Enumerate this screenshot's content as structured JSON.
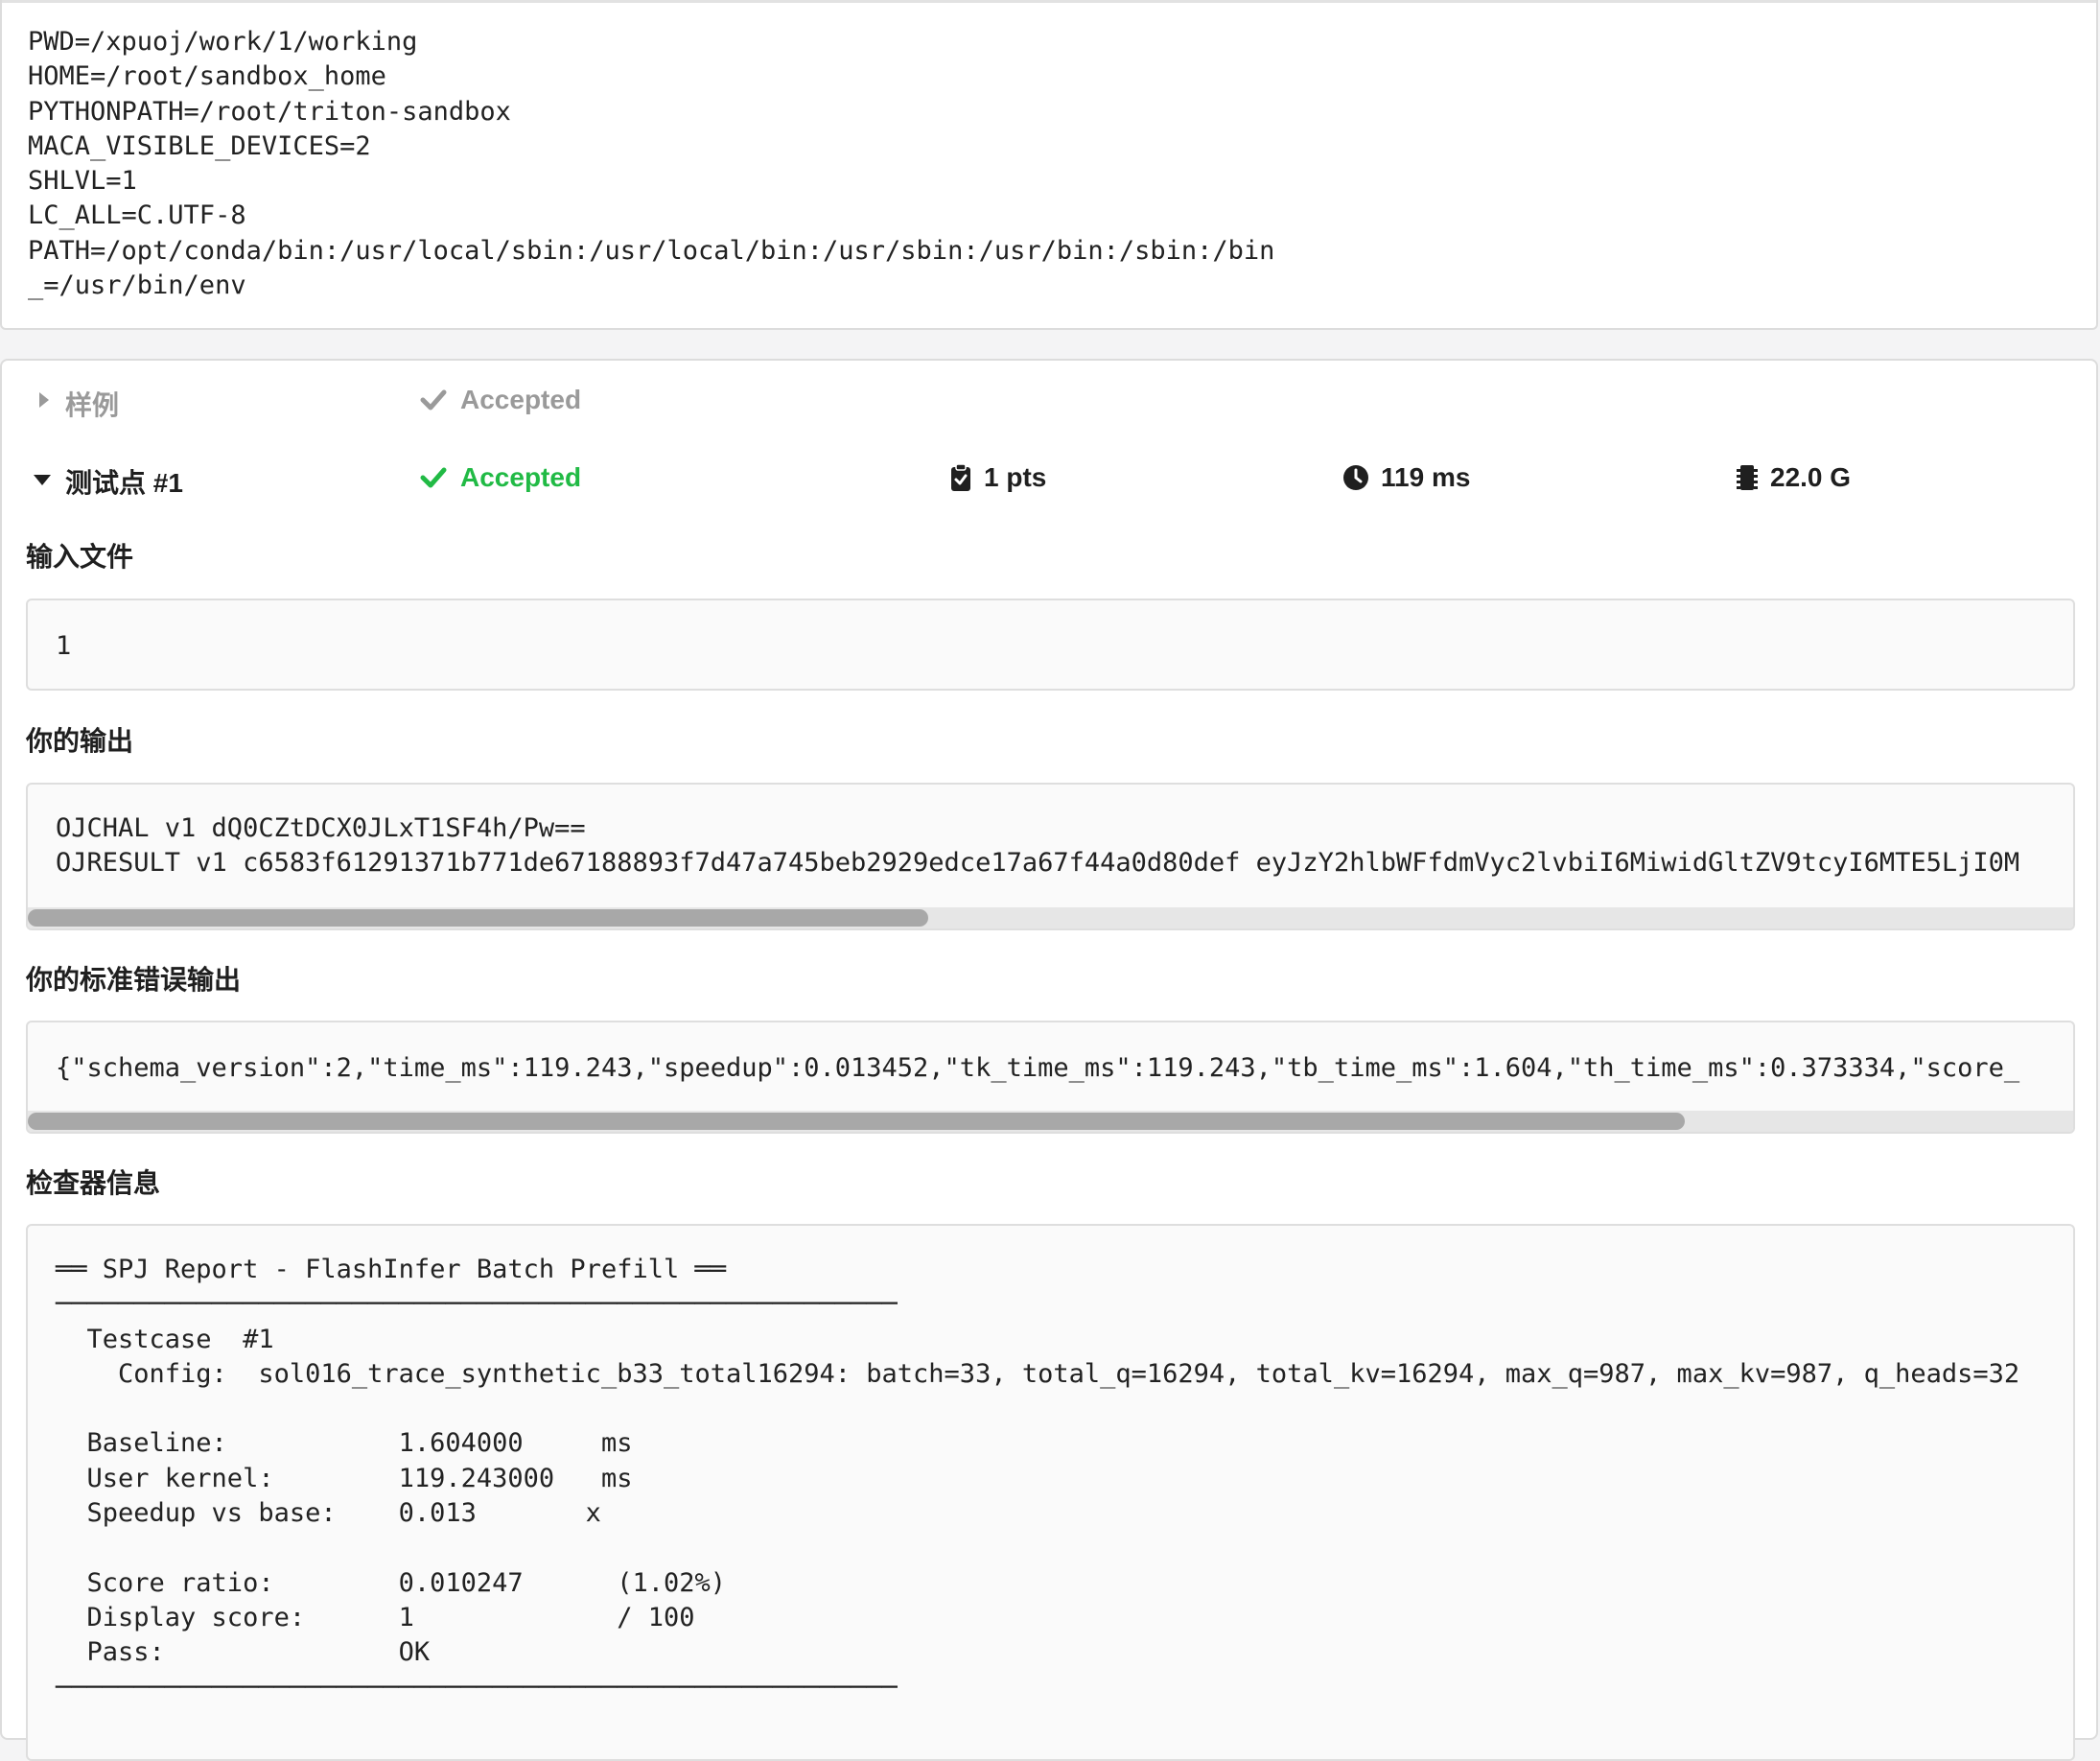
{
  "env": {
    "lines": "PWD=/xpuoj/work/1/working\nHOME=/root/sandbox_home\nPYTHONPATH=/root/triton-sandbox\nMACA_VISIBLE_DEVICES=2\nSHLVL=1\nLC_ALL=C.UTF-8\nPATH=/opt/conda/bin:/usr/local/sbin:/usr/local/bin:/usr/sbin:/usr/bin:/sbin:/bin\n_=/usr/bin/env"
  },
  "sample_row": {
    "label": "样例",
    "status": "Accepted",
    "status_color": "#9a9a9a",
    "icon": "check-icon"
  },
  "test_row": {
    "label": "测试点 #1",
    "status": "Accepted",
    "status_color": "#21ba45",
    "score": "1 pts",
    "time": "119 ms",
    "memory": "22.0 G"
  },
  "sections": {
    "input_title": "输入文件",
    "input_content": "1",
    "output_title": "你的输出",
    "output_content": "OJCHAL v1 dQ0CZtDCX0JLxT1SF4h/Pw==\nOJRESULT v1 c6583f61291371b771de67188893f7d47a745beb2929edce17a67f44a0d80def eyJzY2hlbWFfdmVyc2lvbiI6MiwidGltZV9tcyI6MTE5LjI0M",
    "output_scroll_fraction": 0.44,
    "stderr_title": "你的标准错误输出",
    "stderr_content": "{\"schema_version\":2,\"time_ms\":119.243,\"speedup\":0.013452,\"tk_time_ms\":119.243,\"tb_time_ms\":1.604,\"th_time_ms\":0.373334,\"score_",
    "stderr_scroll_fraction": 0.81,
    "checker_title": "检查器信息",
    "checker_content": "══ SPJ Report - FlashInfer Batch Prefill ══\n──────────────────────────────────────────────────────\n  Testcase  #1\n    Config:  sol016_trace_synthetic_b33_total16294: batch=33, total_q=16294, total_kv=16294, max_q=987, max_kv=987, q_heads=32\n\n  Baseline:           1.604000     ms\n  User kernel:        119.243000   ms\n  Speedup vs base:    0.013       x\n\n  Score ratio:        0.010247      (1.02%)\n  Display score:      1             / 100\n  Pass:               OK\n──────────────────────────────────────────────────────"
  },
  "colors": {
    "accepted_green": "#21ba45",
    "muted_gray": "#9a9a9a"
  }
}
